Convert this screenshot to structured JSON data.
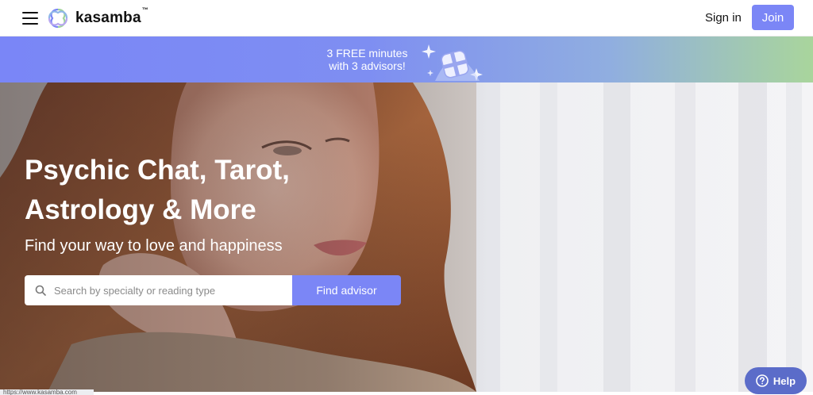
{
  "header": {
    "brand": "kasamba",
    "trademark": "™",
    "sign_in": "Sign in",
    "join": "Join"
  },
  "promo": {
    "line1": "3 FREE minutes",
    "line2": "with 3 advisors!"
  },
  "hero": {
    "title_line1": "Psychic Chat, Tarot,",
    "title_line2": "Astrology & More",
    "subtitle": "Find your way to love and happiness",
    "search_placeholder": "Search by specialty or reading type",
    "find_button": "Find advisor"
  },
  "status_bar": {
    "url": "https://www.kasamba.com"
  },
  "help": {
    "label": "Help"
  },
  "colors": {
    "accent": "#7b86f6",
    "help": "#5b6cc9",
    "promo_start": "#7a86f7",
    "promo_end": "#a9d59c"
  },
  "icons": [
    "menu-icon",
    "kasamba-logo-icon",
    "gift-icon",
    "search-icon",
    "question-icon"
  ]
}
